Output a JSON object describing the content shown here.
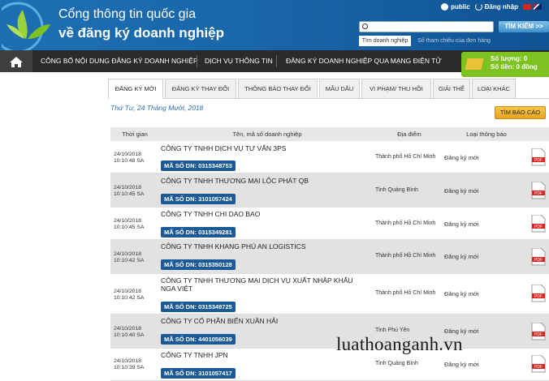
{
  "header": {
    "title_line1": "Cổng thông tin quốc gia",
    "title_line2": "về đăng ký doanh nghiệp",
    "user_label": "public",
    "login_label": "Đăng nhập",
    "search_placeholder": "",
    "search_button": "TÌM KIẾM >>",
    "search_tab_active": "Tìm doanh nghiệp",
    "search_tab_other": "Số tham chiếu của đơn hàng"
  },
  "nav": {
    "items": [
      "CÔNG BỐ NỘI DUNG ĐĂNG KÝ DOANH NGHIỆP",
      "DỊCH VỤ THÔNG TIN",
      "ĐĂNG KÝ DOANH NGHIỆP QUA MẠNG ĐIỆN TỬ"
    ],
    "cart_qty": "Số lượng: 0",
    "cart_amount": "Số tiền: 0 đồng"
  },
  "tabs": [
    "ĐĂNG KÝ MỚI",
    "ĐĂNG KÝ THAY ĐỔI",
    "THÔNG BÁO THAY ĐỔI",
    "MẪU DẤU",
    "VI PHẠM/ THU HỒI",
    "GIẢI THỂ",
    "LOẠI KHÁC"
  ],
  "date": "Thứ Tư, 24 Tháng Mười, 2018",
  "report_button": "TÌM BÁO CÁO",
  "table": {
    "headers": [
      "Thời gian",
      "Tên, mã số doanh nghiệp",
      "Địa điểm",
      "Loại thông báo"
    ],
    "rows": [
      {
        "date": "24/10/2018",
        "time": "10:10:48 SA",
        "name": "CÔNG TY TNHH DỊCH VỤ TƯ VẤN 3PS",
        "code": "MÃ SỐ DN: 0315348753",
        "place": "Thành phố Hồ Chí Minh",
        "type": "Đăng ký mới"
      },
      {
        "date": "24/10/2018",
        "time": "10:10:45 SA",
        "name": "CÔNG TY TNHH THƯƠNG MẠI LỘC PHÁT QB",
        "code": "MÃ SỐ DN: 3101057424",
        "place": "Tỉnh Quảng Bình",
        "type": "Đăng ký mới"
      },
      {
        "date": "24/10/2018",
        "time": "10:10:45 SA",
        "name": "CÔNG TY TNHH CHI DAO BAO",
        "code": "MÃ SỐ DN: 0315349281",
        "place": "Thành phố Hồ Chí Minh",
        "type": "Đăng ký mới"
      },
      {
        "date": "24/10/2018",
        "time": "10:10:42 SA",
        "name": "CÔNG TY TNHH KHANG PHÚ AN LOGISTICS",
        "code": "MÃ SỐ DN: 0315350128",
        "place": "Thành phố Hồ Chí Minh",
        "type": "Đăng ký mới"
      },
      {
        "date": "24/10/2018",
        "time": "10:10:42 SA",
        "name": "CÔNG TY TNHH THƯƠNG MẠI DỊCH VỤ XUẤT NHẬP KHẨU NGA VIỆT",
        "code": "MÃ SỐ DN: 0315349725",
        "place": "Thành phố Hồ Chí Minh",
        "type": "Đăng ký mới"
      },
      {
        "date": "24/10/2018",
        "time": "10:10:40 SA",
        "name": "CÔNG TY CỔ PHẦN BIỂN XUÂN HẢI",
        "code": "MÃ SỐ DN: 4401056039",
        "place": "Tỉnh Phú Yên",
        "type": "Đăng ký mới"
      },
      {
        "date": "24/10/2018",
        "time": "10:10:39 SA",
        "name": "CÔNG TY TNHH JPN",
        "code": "MÃ SỐ DN: 3101057417",
        "place": "Tỉnh Quảng Bình",
        "type": "Đăng ký mới"
      }
    ]
  },
  "watermark": "luathoanganh.vn",
  "icons": {
    "home": "home-icon",
    "pdf": "pdf-icon",
    "cart": "cart-icon",
    "user": "user-icon",
    "power": "power-icon"
  }
}
